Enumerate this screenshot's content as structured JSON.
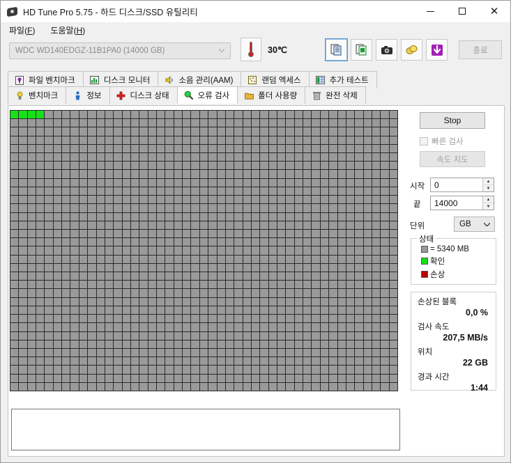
{
  "window": {
    "title": "HD Tune Pro 5.75 - 하드 디스크/SSD 유틸리티",
    "app_icon": "hard-disk-icon",
    "minimize": "—",
    "maximize": "□",
    "close": "✕"
  },
  "menu": {
    "items": [
      {
        "label": "파일",
        "accel": "F"
      },
      {
        "label": "도움말",
        "accel": "H"
      }
    ]
  },
  "toolbar": {
    "drive_value": "WDC WD140EDGZ-11B1PA0 (14000 GB)",
    "drive_disabled": true,
    "temperature": "30℃",
    "temp_icon": "thermometer-icon",
    "buttons": [
      {
        "name": "copy-icon",
        "focused": true
      },
      {
        "name": "copy-to-spreadsheet-icon",
        "focused": false
      },
      {
        "name": "camera-screenshot-icon",
        "focused": false
      },
      {
        "name": "gold-coins-icon",
        "focused": false
      },
      {
        "name": "download-arrow-icon",
        "focused": false
      }
    ],
    "exit_label": "종료",
    "exit_disabled": true
  },
  "tabs": {
    "top_row": [
      {
        "label": "파일 벤치마크",
        "icon": "file-benchmark-icon",
        "active": false
      },
      {
        "label": "디스크 모니터",
        "icon": "disk-monitor-icon",
        "active": false
      },
      {
        "label": "소음 관리(AAM)",
        "icon": "speaker-icon",
        "active": false
      },
      {
        "label": "랜덤 엑세스",
        "icon": "random-access-icon",
        "active": false
      },
      {
        "label": "추가 테스트",
        "icon": "extra-tests-icon",
        "active": false
      }
    ],
    "bottom_row": [
      {
        "label": "벤치마크",
        "icon": "lightbulb-icon",
        "active": false
      },
      {
        "label": "정보",
        "icon": "info-person-icon",
        "active": false
      },
      {
        "label": "디스크 상태",
        "icon": "red-cross-icon",
        "active": false
      },
      {
        "label": "오류 검사",
        "icon": "magnifier-icon",
        "active": true
      },
      {
        "label": "폴더 사용량",
        "icon": "folder-icon",
        "active": false
      },
      {
        "label": "완전 삭제",
        "icon": "trash-icon",
        "active": false
      }
    ]
  },
  "scan": {
    "columns": 45,
    "rows": 33,
    "scanned_ok_cells": 4,
    "damaged_cells": 0,
    "cell_color_unscanned": "#9a9a9a",
    "cell_color_ok": "#18e018",
    "cell_color_bad": "#bb0000",
    "grid_background": "#2a2a2a"
  },
  "controls": {
    "stop_label": "Stop",
    "quick_scan_label": "빠른 검사",
    "quick_scan_checked": false,
    "speed_map_label": "속도 지도",
    "speed_map_disabled": true,
    "start_label": "시작",
    "start_value": "0",
    "end_label": "끝",
    "end_value": "14000",
    "unit_label": "단위",
    "unit_value": "GB",
    "spin_up": "▲",
    "spin_down": "▼",
    "chevron": "⌄"
  },
  "status_legend": {
    "title": "상태",
    "block_size": "= 5340 MB",
    "ok_label": "확인",
    "bad_label": "손상"
  },
  "statistics": {
    "damaged_blocks_label": "손상된 블록",
    "damaged_blocks_value": "0,0 %",
    "scan_speed_label": "검사 속도",
    "scan_speed_value": "207,5 MB/s",
    "position_label": "위치",
    "position_value": "22 GB",
    "elapsed_label": "경과 시간",
    "elapsed_value": "1:44"
  },
  "log": {
    "text": ""
  }
}
